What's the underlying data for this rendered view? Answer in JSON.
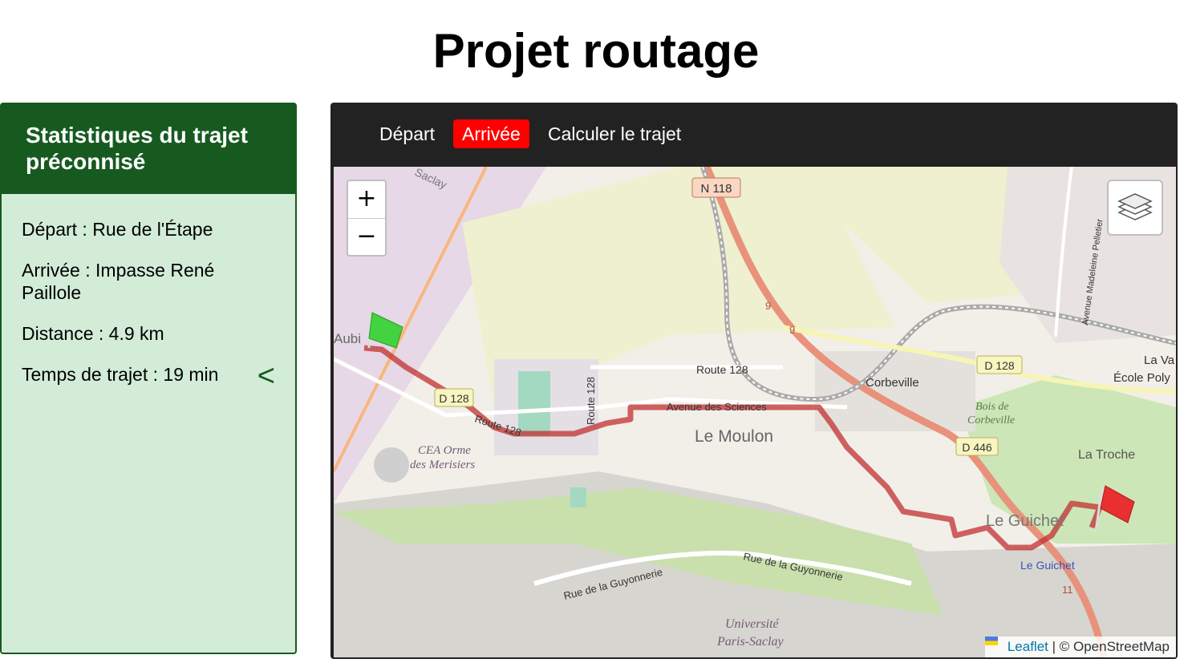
{
  "page": {
    "title": "Projet routage"
  },
  "stats": {
    "title": "Statistiques du trajet préconnisé",
    "depart": "Départ : Rue de l'Étape",
    "arrivee": "Arrivée : Impasse René Paillole",
    "distance": "Distance : 4.9 km",
    "temps": "Temps de trajet : 19 min",
    "collapse_label": "<"
  },
  "toolbar": {
    "depart_label": "Départ",
    "arrivee_label": "Arrivée",
    "calculer_label": "Calculer le trajet",
    "active_color": "#ff0000"
  },
  "map": {
    "zoom_in": "+",
    "zoom_out": "−",
    "attribution_link": "Leaflet",
    "attribution_rest": " | © OpenStreetMap",
    "labels": {
      "n118": "N 118",
      "saclay": "Saclay",
      "aubi": "Aubi",
      "d128_left": "D 128",
      "d128_right": "D 128",
      "route128_a": "Route 128",
      "route128_b": "Route 128",
      "route128_c": "Route 128",
      "avenue_sciences": "Avenue des Sciences",
      "le_moulon": "Le Moulon",
      "cea_1": "CEA Orme",
      "cea_2": "des Merisiers",
      "corbeville": "Corbeville",
      "bois_1": "Bois de",
      "bois_2": "Corbeville",
      "d446": "D 446",
      "la_troche": "La Troche",
      "le_guichet": "Le Guichet",
      "le_guichet_station": "Le Guichet",
      "la_va": "La Va",
      "ecole_poly": "École Poly",
      "ave_madeleine": "Avenue Madeleine Pelletier",
      "guyonnerie_1": "Rue de la Guyonnerie",
      "guyonnerie_2": "Rue de la Guyonnerie",
      "univ_1": "Université",
      "univ_2": "Paris-Saclay",
      "nine_a": "9",
      "nine_b": "9",
      "eleven": "11"
    }
  }
}
